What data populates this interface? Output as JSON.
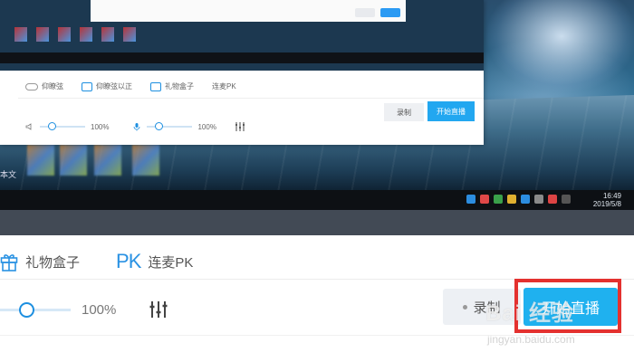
{
  "small_window": {
    "features": [
      {
        "label": "仰瞭弦",
        "icon": "toggle-icon"
      },
      {
        "label": "仰瞭弦以正",
        "icon": "camera-icon"
      },
      {
        "label": "礼物盒子",
        "icon": "gift-icon"
      },
      {
        "label": "连麦PK",
        "icon": "pk-icon"
      }
    ],
    "speaker_volume": "100%",
    "mic_volume": "100%",
    "record_label": "录制",
    "live_label": "开始直播"
  },
  "taskbar": {
    "time": "16:49",
    "date": "2019/5/8"
  },
  "desktop": {
    "icon_label": "本文"
  },
  "toolbar": {
    "gift_label": "礼物盒子",
    "pk_mark": "PK",
    "pk_label": "连麦PK",
    "mic_volume": "100%",
    "mic_level": 0.35,
    "record_label": "录制",
    "live_label": "开始直播"
  },
  "watermark": {
    "text": "Bai 经验",
    "url": "jingyan.baidu.com"
  },
  "colors": {
    "accent": "#1fb1ef",
    "highlight": "#e4312f",
    "icon_blue": "#2a92e3"
  }
}
